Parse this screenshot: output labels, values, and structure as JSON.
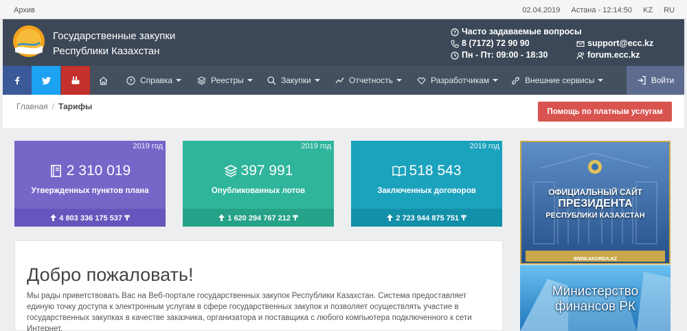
{
  "topbar": {
    "archive": "Архив",
    "date": "02.04.2019",
    "city_time": "Астана - 12:14:50",
    "lang_kz": "KZ",
    "lang_ru": "RU"
  },
  "header": {
    "title_line1": "Государственные закупки",
    "title_line2": "Республики Казахстан",
    "faq": "Часто задаваемые вопросы",
    "phone": "8 (7172) 72 90 90",
    "hours": "Пн - Пт: 09:00 - 18:30",
    "email": "support@ecc.kz",
    "forum": "forum.ecc.kz"
  },
  "nav": {
    "help": "Справка",
    "registries": "Реестры",
    "purchases": "Закупки",
    "reports": "Отчетность",
    "developers": "Разработчикам",
    "external": "Внешние сервисы",
    "login": "Войти"
  },
  "breadcrumb": {
    "home": "Главная",
    "sep": "/",
    "current": "Тарифы"
  },
  "paid_help_button": "Помощь по платным услугам",
  "stats": [
    {
      "year": "2019 год",
      "value": "2 310 019",
      "label": "Утвержденных пунктов плана",
      "total": "4 803 336 175 537 ₸",
      "color": "#7566c8"
    },
    {
      "year": "2019 год",
      "value": "397 991",
      "label": "Опубликованных лотов",
      "total": "1 620 294 767 212 ₸",
      "color": "#2fb59c"
    },
    {
      "year": "2019 год",
      "value": "518 543",
      "label": "Заключенных договоров",
      "total": "2 723 944 875 751 ₸",
      "color": "#1ba2bd"
    }
  ],
  "welcome": {
    "title": "Добро пожаловать!",
    "text": "Мы рады приветствовать Вас на Веб-портале государственных закупок Республики Казахстан. Система предоставляет единую точку доступа к электронным услугам в сфере государственных закупок и позволяет осуществлять участие в государственных закупках в качестве заказчика, организатора и поставщика с любого компьютера подключенного к сети Интернет."
  },
  "banners": {
    "president_line1": "ОФИЦИАЛЬНЫЙ САЙТ",
    "president_line2": "ПРЕЗИДЕНТА",
    "president_line3": "РЕСПУБЛИКИ КАЗАХСТАН",
    "president_url": "WWW.AKORDA.KZ",
    "minfin_line1": "Министерство",
    "minfin_line2": "финансов РК"
  }
}
